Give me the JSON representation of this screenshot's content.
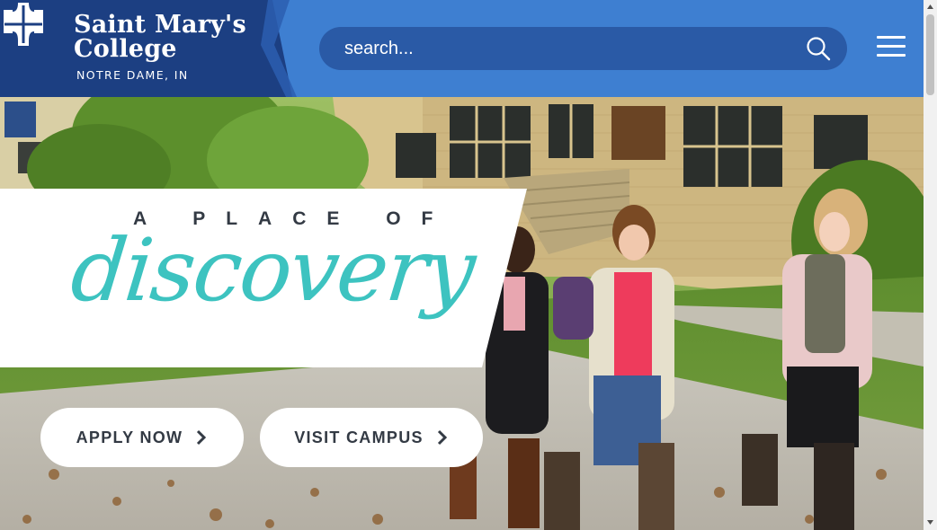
{
  "header": {
    "logo_name_line1": "Saint Mary's",
    "logo_name_line2": "College",
    "logo_location": "NOTRE DAME, IN",
    "search_placeholder": "search..."
  },
  "hero": {
    "tagline_top": "A PLACE OF",
    "tagline_script": "discovery",
    "buttons": [
      {
        "label": "APPLY NOW"
      },
      {
        "label": "VISIT CAMPUS"
      }
    ]
  },
  "icons": {
    "logo": "cross-emblem-icon",
    "search": "search-icon",
    "menu": "hamburger-menu-icon",
    "chevron": "chevron-right-icon"
  },
  "colors": {
    "header_blue": "#3e7fd1",
    "logo_navy": "#1c3f82",
    "search_bg": "#2a5aa6",
    "teal_script": "#3dc3c0",
    "dark_text": "#333a44"
  }
}
